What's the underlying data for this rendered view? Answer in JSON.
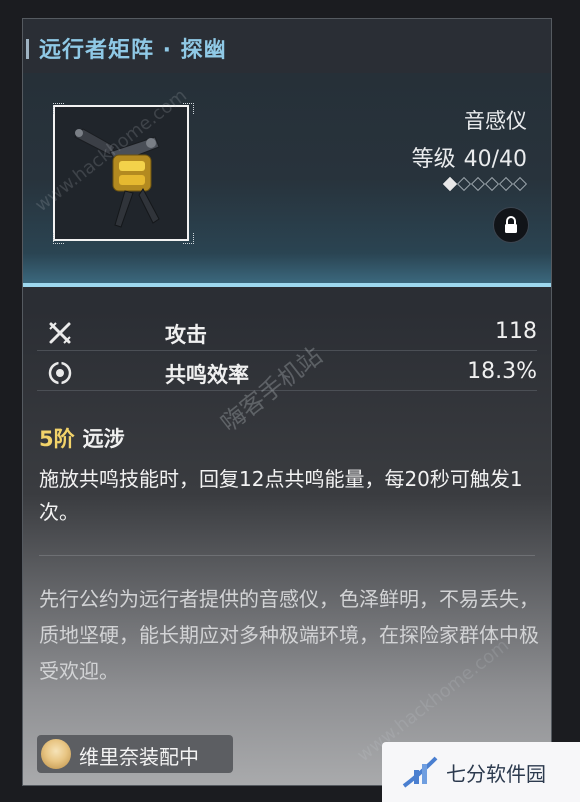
{
  "title": "远行者矩阵 · 探幽",
  "header": {
    "device_type": "音感仪",
    "level_label": "等级",
    "level_value": "40/40",
    "star_levels": {
      "filled": 1,
      "total": 6
    },
    "lock_icon": "lock-icon"
  },
  "stats": [
    {
      "icon": "attack-icon",
      "label": "攻击",
      "value": "118"
    },
    {
      "icon": "energy-regen-icon",
      "label": "共鸣效率",
      "value": "18.3%"
    }
  ],
  "passive": {
    "rank": "5阶",
    "name": "远涉",
    "description": "施放共鸣技能时，回复12点共鸣能量，每20秒可触发1次。"
  },
  "lore": "先行公约为远行者提供的音感仪，色泽鲜明，不易丢失，质地坚硬，能长期应对多种极端环境，在探险家群体中极受欢迎。",
  "equipped": {
    "text": "维里奈装配中"
  },
  "watermarks": {
    "site_cn": "嗨客手机站",
    "site_en_1": "www.hackhome.com",
    "site_en_2": "www.hackhome.com",
    "logo_text": "七分软件园"
  },
  "colors": {
    "title": "#8fc9e6",
    "accent_line": "#9ed8ef",
    "rank": "#f2d36a"
  }
}
